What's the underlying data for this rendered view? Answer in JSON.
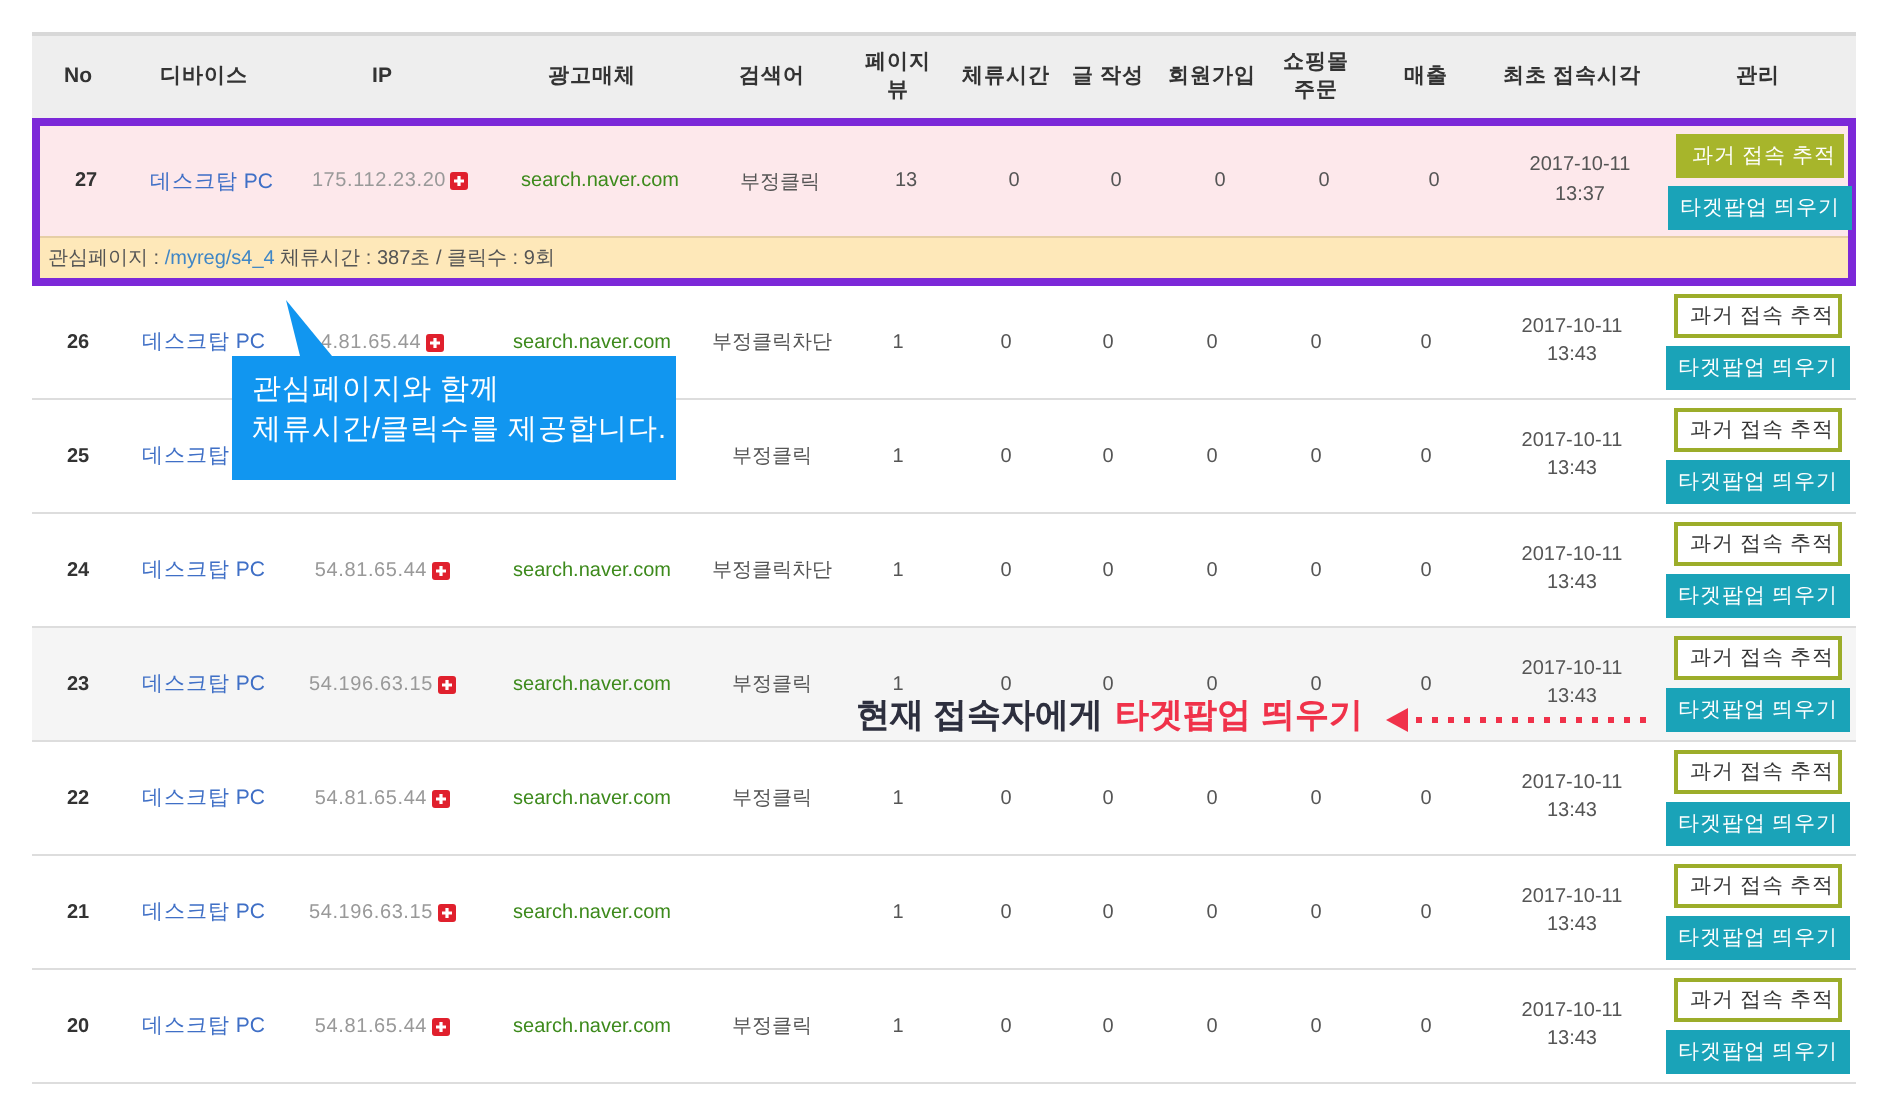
{
  "columns": [
    "No",
    "디바이스",
    "IP",
    "광고매체",
    "검색어",
    "페이지\n뷰",
    "체류시간",
    "글 작성",
    "회원가입",
    "쇼핑몰\n주문",
    "매출",
    "최초 접속시각",
    "관리"
  ],
  "rows": [
    {
      "no": "27",
      "device": "데스크탑 PC",
      "ip": "175.112.23.20",
      "medium": "search.naver.com",
      "keyword": "부정클릭",
      "pageviews": "13",
      "dwell": "0",
      "posts": "0",
      "signups": "0",
      "orders": "0",
      "sales": "0",
      "date": "2017-10-11",
      "time": "13:37",
      "selected": true,
      "hovered": false,
      "buttons": [
        "과거 접속 추적",
        "타겟팝업 띄우기"
      ],
      "detail": {
        "label": "관심페이지 :",
        "link": "/myreg/s4_4",
        "rest": "체류시간 : 387초 / 클릭수 : 9회"
      }
    },
    {
      "no": "26",
      "device": "데스크탑 PC",
      "ip": "4.81.65.44",
      "medium": "search.naver.com",
      "keyword": "부정클릭차단",
      "pageviews": "1",
      "dwell": "0",
      "posts": "0",
      "signups": "0",
      "orders": "0",
      "sales": "0",
      "date": "2017-10-11",
      "time": "13:43",
      "selected": false,
      "hovered": false,
      "buttons": [
        "과거 접속 추적",
        "타겟팝업 띄우기"
      ]
    },
    {
      "no": "25",
      "device": "데스크탑",
      "keyword": "부정클릭",
      "pageviews": "1",
      "dwell": "0",
      "posts": "0",
      "signups": "0",
      "orders": "0",
      "sales": "0",
      "date": "2017-10-11",
      "time": "13:43",
      "selected": false,
      "hovered": false,
      "buttons": [
        "과거 접속 추적",
        "타겟팝업 띄우기"
      ]
    },
    {
      "no": "24",
      "device": "데스크탑 PC",
      "ip": "54.81.65.44",
      "medium": "search.naver.com",
      "keyword": "부정클릭차단",
      "pageviews": "1",
      "dwell": "0",
      "posts": "0",
      "signups": "0",
      "orders": "0",
      "sales": "0",
      "date": "2017-10-11",
      "time": "13:43",
      "selected": false,
      "hovered": false,
      "buttons": [
        "과거 접속 추적",
        "타겟팝업 띄우기"
      ]
    },
    {
      "no": "23",
      "device": "데스크탑 PC",
      "ip": "54.196.63.15",
      "medium": "search.naver.com",
      "keyword": "부정클릭",
      "pageviews": "1",
      "dwell": "0",
      "posts": "0",
      "signups": "0",
      "orders": "0",
      "sales": "0",
      "date": "2017-10-11",
      "time": "13:43",
      "selected": false,
      "hovered": true,
      "buttons": [
        "과거 접속 추적",
        "타겟팝업 띄우기"
      ]
    },
    {
      "no": "22",
      "device": "데스크탑 PC",
      "ip": "54.81.65.44",
      "medium": "search.naver.com",
      "keyword": "부정클릭",
      "pageviews": "1",
      "dwell": "0",
      "posts": "0",
      "signups": "0",
      "orders": "0",
      "sales": "0",
      "date": "2017-10-11",
      "time": "13:43",
      "selected": false,
      "hovered": false,
      "buttons": [
        "과거 접속 추적",
        "타겟팝업 띄우기"
      ]
    },
    {
      "no": "21",
      "device": "데스크탑 PC",
      "ip": "54.196.63.15",
      "medium": "search.naver.com",
      "pageviews": "1",
      "dwell": "0",
      "posts": "0",
      "signups": "0",
      "orders": "0",
      "sales": "0",
      "date": "2017-10-11",
      "time": "13:43",
      "selected": false,
      "hovered": false,
      "buttons": [
        "과거 접속 추적",
        "타겟팝업 띄우기"
      ]
    },
    {
      "no": "20",
      "device": "데스크탑 PC",
      "ip": "54.81.65.44",
      "medium": "search.naver.com",
      "keyword": "부정클릭",
      "pageviews": "1",
      "dwell": "0",
      "posts": "0",
      "signups": "0",
      "orders": "0",
      "sales": "0",
      "date": "2017-10-11",
      "time": "13:43",
      "selected": false,
      "hovered": false,
      "buttons": [
        "과거 접속 추적",
        "타겟팝업 띄우기"
      ]
    }
  ],
  "callout": {
    "lines": [
      "관심페이지와 함께",
      "체류시간/클릭수를 제공합니다."
    ]
  },
  "annotation": {
    "lead": "현재 접속자에게",
    "highlight": "타겟팝업 띄우기"
  }
}
